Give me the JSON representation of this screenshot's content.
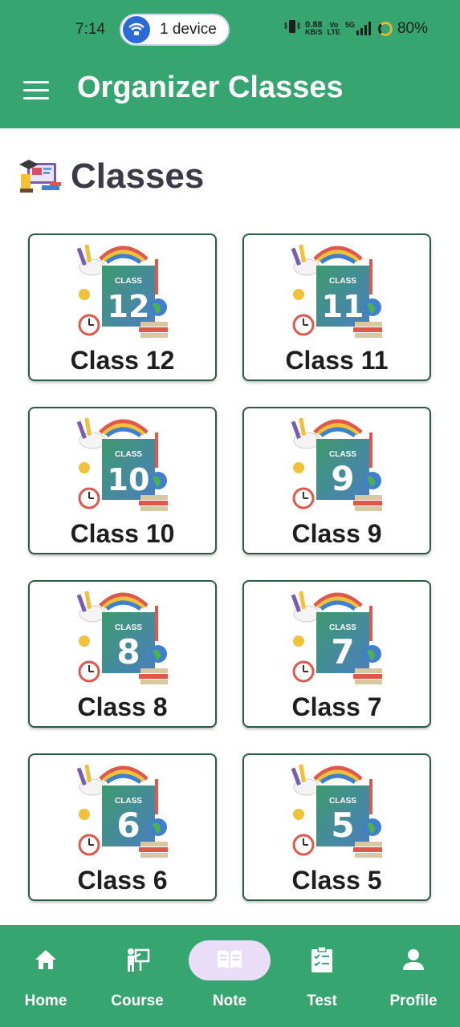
{
  "status_bar": {
    "time": "7:14",
    "device_pill": "1 device",
    "speed_value": "0.88",
    "speed_unit": "KB/S",
    "volte_top": "Vo",
    "volte_bottom": "LTE",
    "network": "5G",
    "battery": "80%"
  },
  "app_bar": {
    "title": "Organizer Classes",
    "menu_icon": "hamburger-menu-icon"
  },
  "section": {
    "title": "Classes",
    "icon": "classroom-illustration"
  },
  "classes": [
    {
      "label": "Class 12",
      "number": "12"
    },
    {
      "label": "Class 11",
      "number": "11"
    },
    {
      "label": "Class 10",
      "number": "10"
    },
    {
      "label": "Class 9",
      "number": "9"
    },
    {
      "label": "Class 8",
      "number": "8"
    },
    {
      "label": "Class 7",
      "number": "7"
    },
    {
      "label": "Class 6",
      "number": "6"
    },
    {
      "label": "Class 5",
      "number": "5"
    }
  ],
  "class_art_word": "CLASS",
  "bottom_nav": {
    "active": "Note",
    "items": [
      {
        "label": "Home",
        "icon": "home-icon"
      },
      {
        "label": "Course",
        "icon": "teacher-board-icon"
      },
      {
        "label": "Note",
        "icon": "open-book-icon"
      },
      {
        "label": "Test",
        "icon": "clipboard-checklist-icon"
      },
      {
        "label": "Profile",
        "icon": "person-icon"
      }
    ]
  },
  "colors": {
    "primary": "#36a56f",
    "card_border": "#2e5a44",
    "active_pill": "#e9ddf8",
    "title_text": "#3b3b48"
  }
}
